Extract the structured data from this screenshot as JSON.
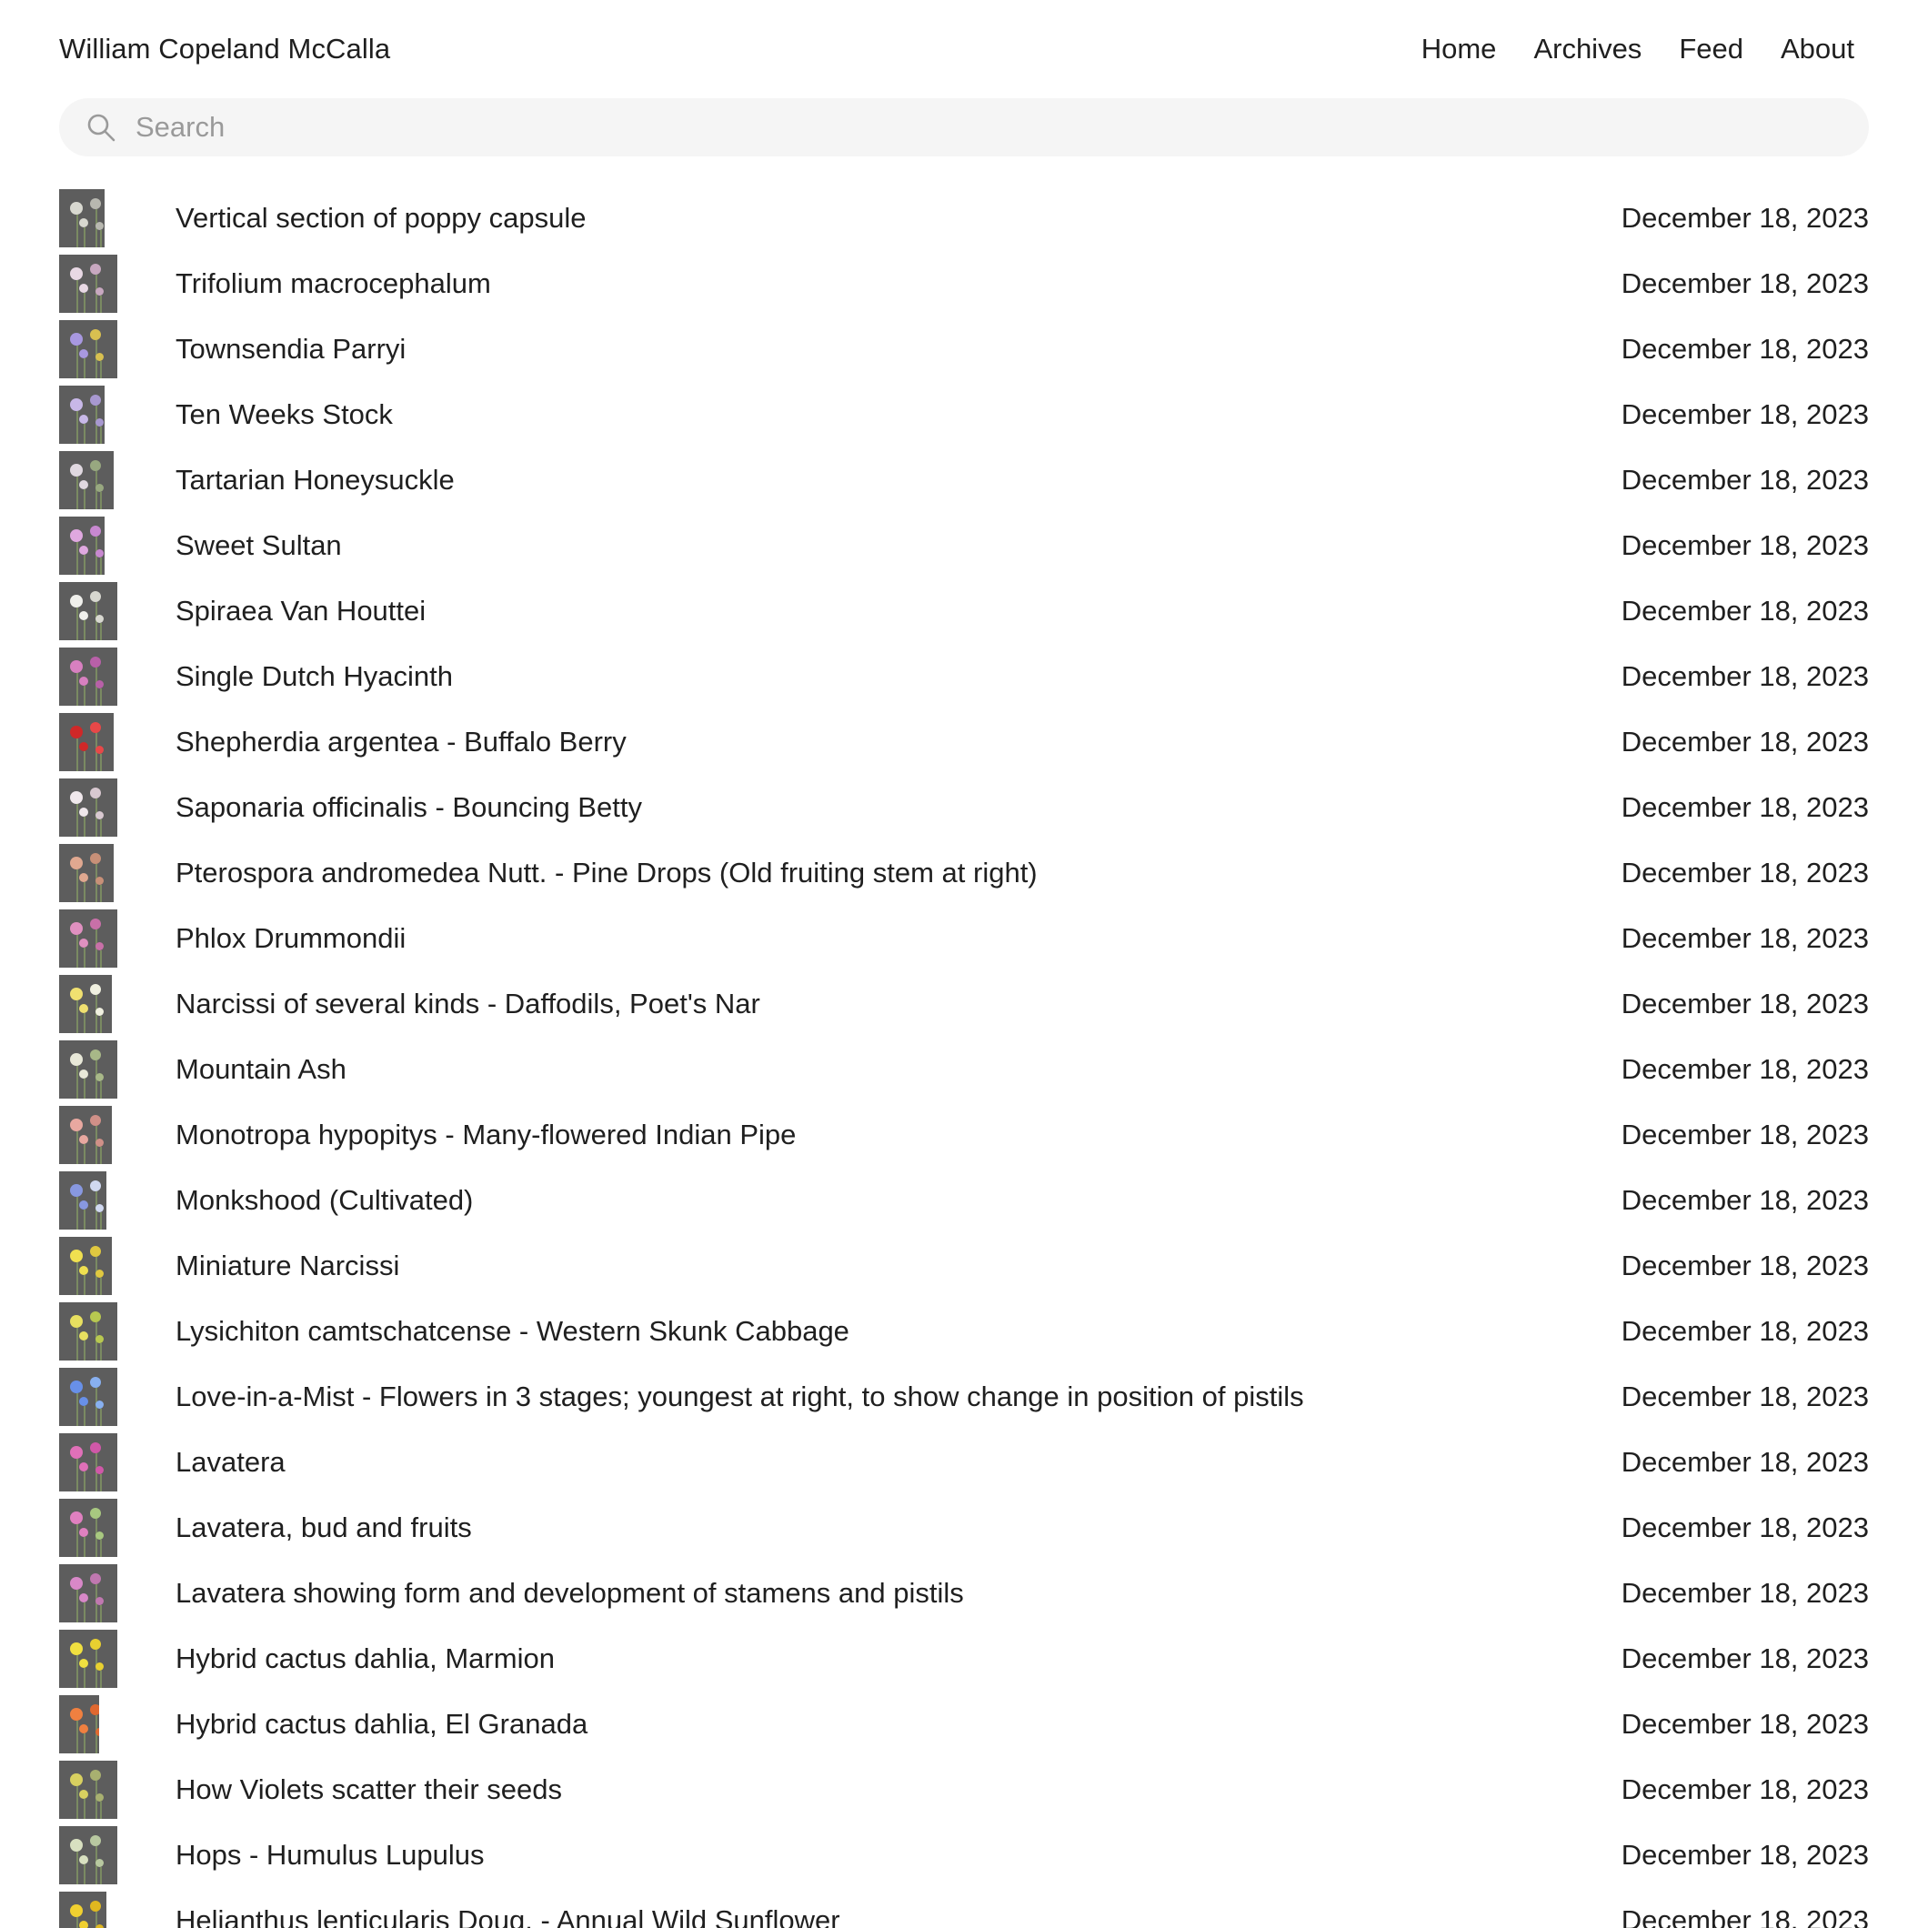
{
  "header": {
    "site_title": "William Copeland McCalla",
    "nav": [
      "Home",
      "Archives",
      "Feed",
      "About"
    ]
  },
  "search": {
    "placeholder": "Search",
    "icon": "search-icon"
  },
  "colors": {
    "search_bg": "#f5f5f5",
    "thumb_bg": "#5d5d5d",
    "text": "#1f1f1f",
    "placeholder": "#9a9a9a"
  },
  "posts": [
    {
      "title": "Vertical section of poppy capsule",
      "date": "December 18, 2023",
      "thumb_colors": [
        "#d8d8d0",
        "#b8b8b0"
      ]
    },
    {
      "title": "Trifolium macrocephalum",
      "date": "December 18, 2023",
      "thumb_colors": [
        "#e8d8e4",
        "#c8a8c0"
      ]
    },
    {
      "title": "Townsendia Parryi",
      "date": "December 18, 2023",
      "thumb_colors": [
        "#a898e0",
        "#d8c050"
      ]
    },
    {
      "title": "Ten Weeks Stock",
      "date": "December 18, 2023",
      "thumb_colors": [
        "#c8b8e8",
        "#a898d0"
      ]
    },
    {
      "title": "Tartarian Honeysuckle",
      "date": "December 18, 2023",
      "thumb_colors": [
        "#e0d8e0",
        "#98a880"
      ]
    },
    {
      "title": "Sweet Sultan",
      "date": "December 18, 2023",
      "thumb_colors": [
        "#e0a8e0",
        "#c888d0"
      ]
    },
    {
      "title": "Spiraea Van Houttei",
      "date": "December 18, 2023",
      "thumb_colors": [
        "#f0f0ec",
        "#d8d8d0"
      ]
    },
    {
      "title": "Single Dutch Hyacinth",
      "date": "December 18, 2023",
      "thumb_colors": [
        "#d880c0",
        "#b860a8"
      ]
    },
    {
      "title": "Shepherdia argentea - Buffalo Berry",
      "date": "December 18, 2023",
      "thumb_colors": [
        "#d02828",
        "#e84848"
      ]
    },
    {
      "title": "Saponaria officinalis - Bouncing Betty",
      "date": "December 18, 2023",
      "thumb_colors": [
        "#f0e8ec",
        "#d8c8d0"
      ]
    },
    {
      "title": "Pterospora andromedea Nutt. - Pine Drops (Old fruiting stem at right)",
      "date": "December 18, 2023",
      "thumb_colors": [
        "#e0a890",
        "#c89078"
      ]
    },
    {
      "title": "Phlox Drummondii",
      "date": "December 18, 2023",
      "thumb_colors": [
        "#e090c0",
        "#c870a8"
      ]
    },
    {
      "title": "Narcissi of several kinds - Daffodils, Poet's Nar",
      "date": "December 18, 2023",
      "thumb_colors": [
        "#f0e070",
        "#f0f0e0"
      ]
    },
    {
      "title": "Mountain Ash",
      "date": "December 18, 2023",
      "thumb_colors": [
        "#e8e8d8",
        "#a8b888"
      ]
    },
    {
      "title": "Monotropa hypopitys - Many-flowered Indian Pipe",
      "date": "December 18, 2023",
      "thumb_colors": [
        "#e8a8a0",
        "#d09088"
      ]
    },
    {
      "title": "Monkshood (Cultivated)",
      "date": "December 18, 2023",
      "thumb_colors": [
        "#8898e0",
        "#d0d8f0"
      ]
    },
    {
      "title": "Miniature Narcissi",
      "date": "December 18, 2023",
      "thumb_colors": [
        "#f0e050",
        "#e0c840"
      ]
    },
    {
      "title": "Lysichiton camtschatcense - Western Skunk Cabbage",
      "date": "December 18, 2023",
      "thumb_colors": [
        "#e8e060",
        "#b8c850"
      ]
    },
    {
      "title": "Love-in-a-Mist - Flowers in 3 stages; youngest at right, to show change in position of pistils",
      "date": "December 18, 2023",
      "thumb_colors": [
        "#6890e8",
        "#88b0f0"
      ]
    },
    {
      "title": "Lavatera",
      "date": "December 18, 2023",
      "thumb_colors": [
        "#e070b8",
        "#d058a8"
      ]
    },
    {
      "title": "Lavatera, bud and fruits",
      "date": "December 18, 2023",
      "thumb_colors": [
        "#e080c0",
        "#a8c880"
      ]
    },
    {
      "title": "Lavatera showing form and development of stamens and pistils",
      "date": "December 18, 2023",
      "thumb_colors": [
        "#d888c8",
        "#c078b0"
      ]
    },
    {
      "title": "Hybrid cactus dahlia, Marmion",
      "date": "December 18, 2023",
      "thumb_colors": [
        "#f0e040",
        "#e8d030"
      ]
    },
    {
      "title": "Hybrid cactus dahlia, El Granada",
      "date": "December 18, 2023",
      "thumb_colors": [
        "#f08040",
        "#e06830"
      ]
    },
    {
      "title": "How Violets scatter their seeds",
      "date": "December 18, 2023",
      "thumb_colors": [
        "#d8d060",
        "#a8b070"
      ]
    },
    {
      "title": "Hops - Humulus Lupulus",
      "date": "December 18, 2023",
      "thumb_colors": [
        "#d8e0c0",
        "#b8c8a0"
      ]
    },
    {
      "title": "Helianthus lenticularis Doug. - Annual Wild Sunflower",
      "date": "December 18, 2023",
      "thumb_colors": [
        "#f0d030",
        "#e0b820"
      ]
    }
  ]
}
